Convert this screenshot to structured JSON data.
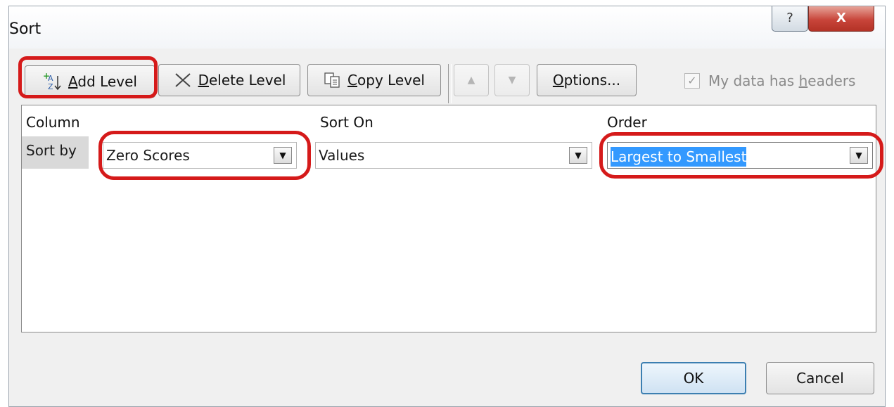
{
  "dialog": {
    "title": "Sort",
    "help_glyph": "?",
    "close_glyph": "X"
  },
  "toolbar": {
    "add_level": {
      "icon": "sort-az-add-icon",
      "accel": "A",
      "rest": "dd Level"
    },
    "delete_level": {
      "icon": "x-icon",
      "accel": "D",
      "rest": "elete Level"
    },
    "copy_level": {
      "icon": "copy-icon",
      "accel": "C",
      "rest": "opy Level"
    },
    "move_up": "▲",
    "move_down": "▼",
    "options": {
      "accel": "O",
      "rest": "ptions..."
    },
    "headers_checkbox": {
      "checked": true,
      "text_pre": "My data has ",
      "accel": "h",
      "text_post": "eaders"
    }
  },
  "grid": {
    "headers": {
      "column": "Column",
      "sort_on": "Sort On",
      "order": "Order"
    },
    "rows": [
      {
        "label": "Sort by",
        "column": "Zero Scores",
        "sort_on": "Values",
        "order": "Largest to Smallest"
      }
    ]
  },
  "footer": {
    "ok": "OK",
    "cancel": "Cancel"
  },
  "colors": {
    "highlight": "#d51a1a",
    "selection": "#3399ff"
  }
}
